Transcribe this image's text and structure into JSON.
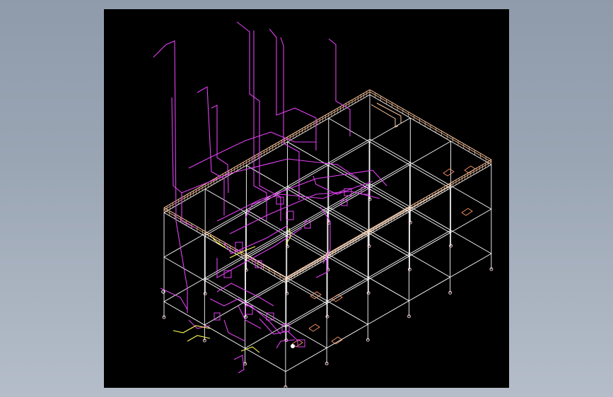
{
  "viewport": {
    "background": "#000000",
    "view": "isometric",
    "model": "structural-frame-with-piping"
  },
  "colors": {
    "page_background_top": "#8f9bab",
    "page_background_bottom": "#b4bdc9",
    "structure": "#ffffff",
    "walkway_railing": "#ffc9a0",
    "piping": "#e040f0",
    "piping_accent": "#ffff55",
    "floor_openings": "#ff9966"
  },
  "structure": {
    "bays_long": 5,
    "bays_short": 3,
    "levels": 3,
    "walkway_sides": [
      "rear-long-edge",
      "left-short-edge"
    ],
    "stair_at": "rear-right-corner"
  }
}
